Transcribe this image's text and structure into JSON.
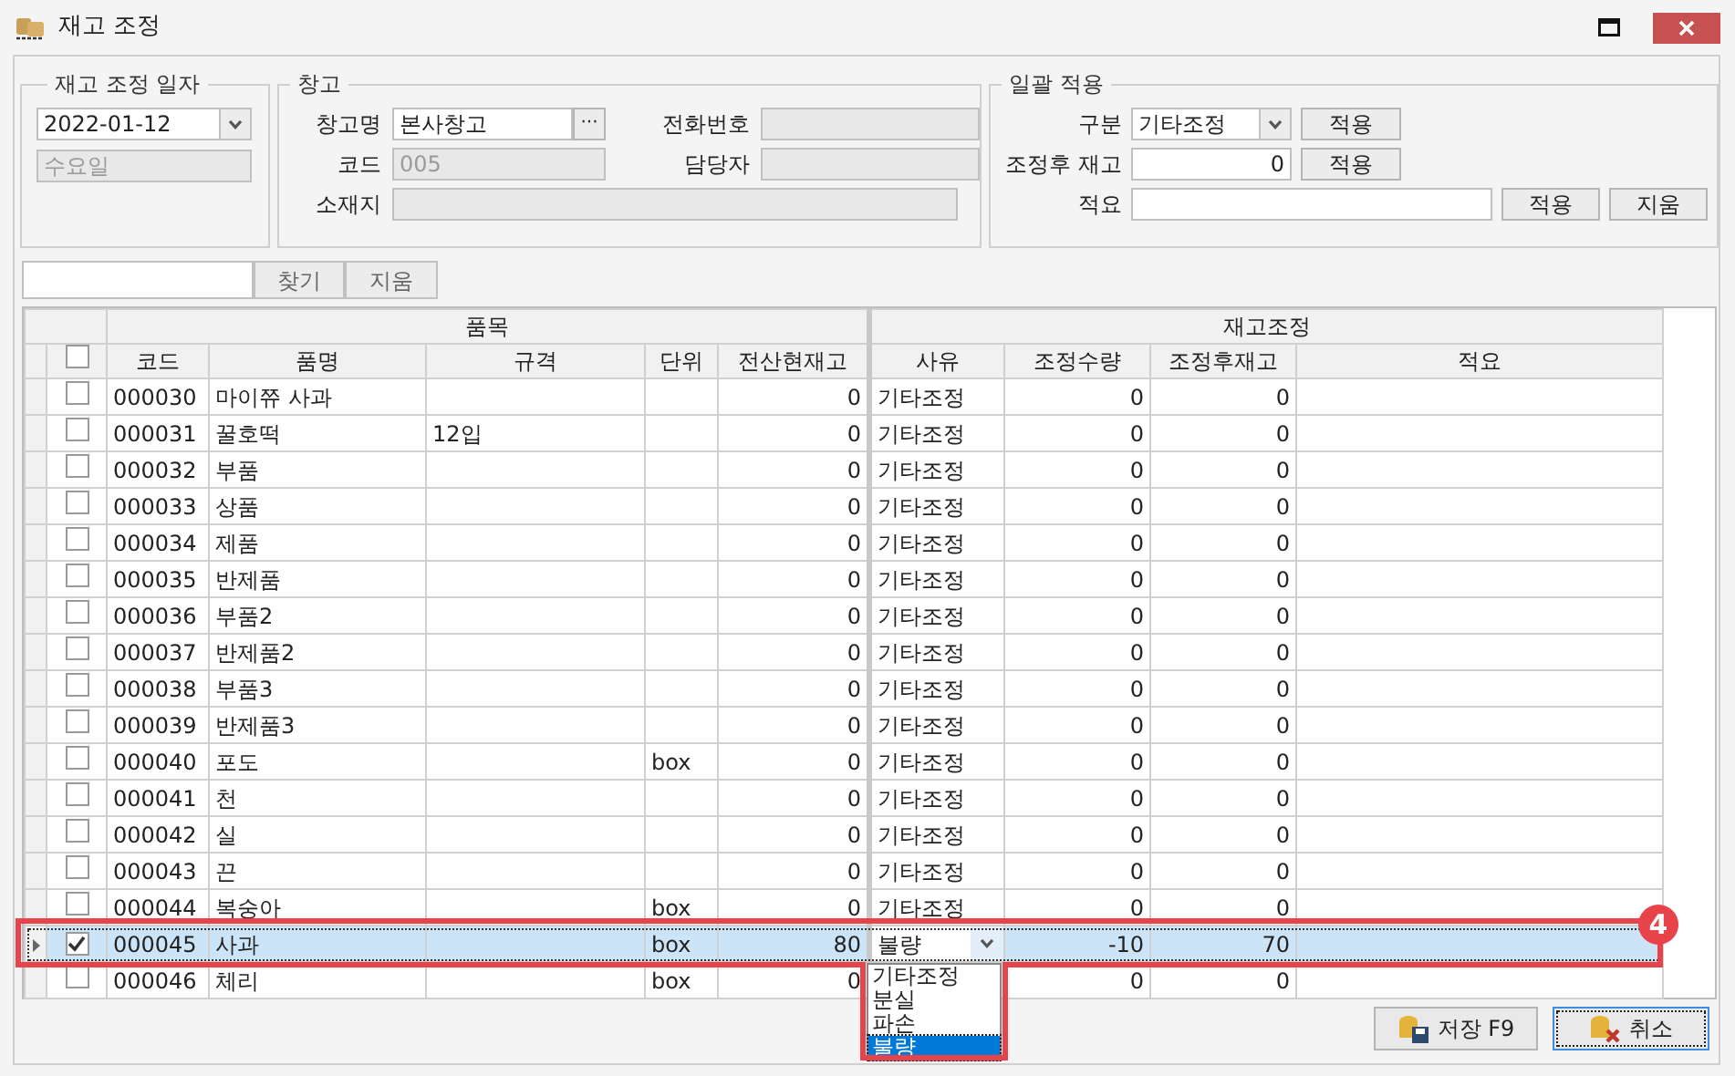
{
  "window": {
    "title": "재고 조정"
  },
  "date_group": {
    "title": "재고 조정 일자",
    "date": "2022-01-12",
    "weekday": {
      "value": "수요일",
      "disabled": true
    }
  },
  "warehouse": {
    "title": "창고",
    "name_label": "창고명",
    "name_value": "본사창고",
    "lookup_button": "···",
    "code_label": "코드",
    "code_value": {
      "value": "005",
      "disabled": true
    },
    "address_label": "소재지",
    "phone_label": "전화번호",
    "manager_label": "담당자"
  },
  "bulk": {
    "title": "일괄 적용",
    "type_label": "구분",
    "type_value": "기타조정",
    "type_button": "적용",
    "after_label": "조정후 재고",
    "after_value": "0",
    "after_button": "적용",
    "note_label": "적요",
    "note_button": "적용",
    "clear_button": "지움"
  },
  "search": {
    "find_button": "찾기",
    "clear_button": "지움"
  },
  "table": {
    "groups": [
      "품목",
      "재고조정"
    ],
    "header_checked": false,
    "columns": [
      "코드",
      "품명",
      "규격",
      "단위",
      "전산현재고",
      "사유",
      "조정수량",
      "조정후재고",
      "적요"
    ],
    "rows": [
      {
        "checked": false,
        "selected": false,
        "code": "000030",
        "name": "마이쮸 사과",
        "stock": "0",
        "reason": "기타조정",
        "qty": "0",
        "after": "0"
      },
      {
        "checked": false,
        "selected": false,
        "code": "000031",
        "name": "꿀호떡",
        "spec": "12입",
        "stock": "0",
        "reason": "기타조정",
        "qty": "0",
        "after": "0"
      },
      {
        "checked": false,
        "selected": false,
        "code": "000032",
        "name": "부품",
        "stock": "0",
        "reason": "기타조정",
        "qty": "0",
        "after": "0"
      },
      {
        "checked": false,
        "selected": false,
        "code": "000033",
        "name": "상품",
        "stock": "0",
        "reason": "기타조정",
        "qty": "0",
        "after": "0"
      },
      {
        "checked": false,
        "selected": false,
        "code": "000034",
        "name": "제품",
        "stock": "0",
        "reason": "기타조정",
        "qty": "0",
        "after": "0"
      },
      {
        "checked": false,
        "selected": false,
        "code": "000035",
        "name": "반제품",
        "stock": "0",
        "reason": "기타조정",
        "qty": "0",
        "after": "0"
      },
      {
        "checked": false,
        "selected": false,
        "code": "000036",
        "name": "부품2",
        "stock": "0",
        "reason": "기타조정",
        "qty": "0",
        "after": "0"
      },
      {
        "checked": false,
        "selected": false,
        "code": "000037",
        "name": "반제품2",
        "stock": "0",
        "reason": "기타조정",
        "qty": "0",
        "after": "0"
      },
      {
        "checked": false,
        "selected": false,
        "code": "000038",
        "name": "부품3",
        "stock": "0",
        "reason": "기타조정",
        "qty": "0",
        "after": "0"
      },
      {
        "checked": false,
        "selected": false,
        "code": "000039",
        "name": "반제품3",
        "stock": "0",
        "reason": "기타조정",
        "qty": "0",
        "after": "0"
      },
      {
        "checked": false,
        "selected": false,
        "code": "000040",
        "name": "포도",
        "unit": "box",
        "stock": "0",
        "reason": "기타조정",
        "qty": "0",
        "after": "0"
      },
      {
        "checked": false,
        "selected": false,
        "code": "000041",
        "name": "천",
        "stock": "0",
        "reason": "기타조정",
        "qty": "0",
        "after": "0"
      },
      {
        "checked": false,
        "selected": false,
        "code": "000042",
        "name": "실",
        "stock": "0",
        "reason": "기타조정",
        "qty": "0",
        "after": "0"
      },
      {
        "checked": false,
        "selected": false,
        "code": "000043",
        "name": "끈",
        "stock": "0",
        "reason": "기타조정",
        "qty": "0",
        "after": "0"
      },
      {
        "checked": false,
        "selected": false,
        "code": "000044",
        "name": "복숭아",
        "unit": "box",
        "stock": "0",
        "reason": "기타조정",
        "qty": "0",
        "after": "0"
      },
      {
        "checked": true,
        "selected": true,
        "code": "000045",
        "name": "사과",
        "unit": "box",
        "stock": "80",
        "reason": "불량",
        "qty": "-10",
        "after": "70"
      },
      {
        "checked": false,
        "selected": false,
        "code": "000046",
        "name": "체리",
        "unit": "box",
        "stock": "0",
        "qty": "0",
        "after": "0"
      }
    ]
  },
  "dropdown": {
    "options": [
      {
        "label": "기타조정",
        "selected": false
      },
      {
        "label": "분실",
        "selected": false
      },
      {
        "label": "파손",
        "selected": false
      },
      {
        "label": "불량",
        "selected": true
      }
    ]
  },
  "buttons": {
    "save": "저장 F9",
    "cancel": "취소"
  },
  "annotation": {
    "badge": "4"
  }
}
